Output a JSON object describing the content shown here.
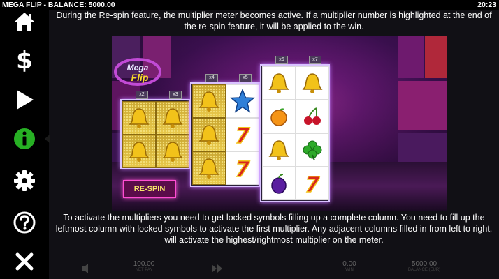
{
  "header": {
    "title": "MEGA FLIP - BALANCE: 5000.00",
    "time": "20:23"
  },
  "sidebar": {
    "items": [
      {
        "icon": "home-icon"
      },
      {
        "icon": "dollar-icon"
      },
      {
        "icon": "play-icon"
      },
      {
        "icon": "info-icon",
        "active": true,
        "color": "#27b024"
      },
      {
        "icon": "gear-icon"
      },
      {
        "icon": "help-icon"
      },
      {
        "icon": "close-icon"
      }
    ]
  },
  "help": {
    "paragraph1": "During the Re-spin feature, the multiplier meter becomes active. If a multiplier number is highlighted at the end of the re-spin feature, it will be applied to the win.",
    "paragraph2": "To activate the multipliers you need to get locked symbols filling up a complete column. You need to fill up the leftmost column with locked symbols to activate the first multiplier. Any adjacent columns filled in from left to right, will activate the highest/rightmost multiplier on the meter."
  },
  "illustration": {
    "logo_line1": "Mega",
    "logo_line2": "Flip",
    "respin_label": "RE-SPIN",
    "multipliers": [
      "x2",
      "x3",
      "x4",
      "x5",
      "x6",
      "x7"
    ],
    "grid_left": [
      [
        "bell",
        "bell"
      ],
      [
        "bell",
        "bell"
      ]
    ],
    "grid_mid": [
      [
        "bell",
        "star"
      ],
      [
        "bell",
        "seven"
      ],
      [
        "bell",
        "seven"
      ]
    ],
    "grid_right": [
      [
        "bell",
        "bell"
      ],
      [
        "orange",
        "cherry"
      ],
      [
        "bell",
        "clover"
      ],
      [
        "plum",
        "seven"
      ]
    ]
  },
  "bottom_bar": {
    "bet_value": "100.00",
    "bet_label": "NET PAY",
    "win_value": "0.00",
    "win_label": "WIN",
    "balance_value": "5000.00",
    "balance_label": "BALANCE (EUR)"
  },
  "colors": {
    "accent_green": "#27b024",
    "neon_pink": "#ff4dd2",
    "bell_gold": "#f2c21a"
  }
}
